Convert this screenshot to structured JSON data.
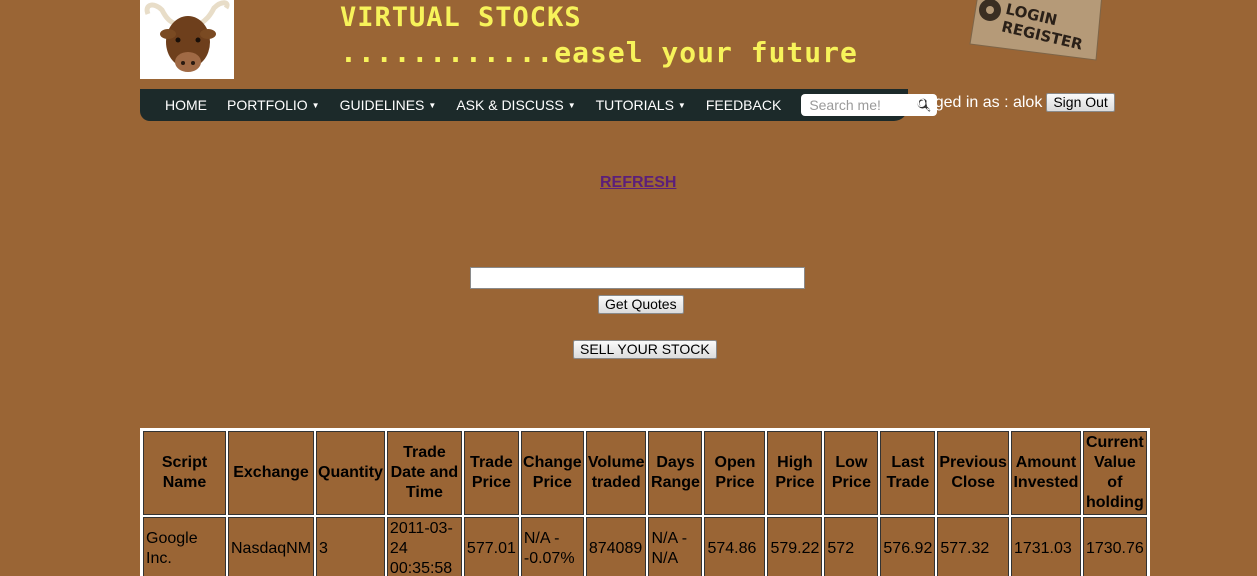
{
  "header": {
    "title": "VIRTUAL STOCKS",
    "tagline": "............easel your future",
    "login_tag": {
      "line1": "LOGIN",
      "line2": "REGISTER"
    }
  },
  "nav": {
    "items": [
      {
        "label": "HOME",
        "has_dropdown": false
      },
      {
        "label": "PORTFOLIO",
        "has_dropdown": true
      },
      {
        "label": "GUIDELINES",
        "has_dropdown": true
      },
      {
        "label": "ASK & DISCUSS",
        "has_dropdown": true
      },
      {
        "label": "TUTORIALS",
        "has_dropdown": true
      },
      {
        "label": "FEEDBACK",
        "has_dropdown": false
      }
    ],
    "search_placeholder": "Search me!"
  },
  "user": {
    "logged_in_text": "Logged in as : alok",
    "sign_out_label": "Sign Out"
  },
  "actions": {
    "refresh_label": "REFRESH",
    "quote_input_value": "",
    "get_quotes_label": "Get Quotes",
    "sell_stock_label": "SELL YOUR STOCK"
  },
  "holdings": {
    "columns": [
      "Script Name",
      "Exchange",
      "Quantity",
      "Trade Date and Time",
      "Trade Price",
      "Change Price",
      "Volume traded",
      "Days Range",
      "Open Price",
      "High Price",
      "Low Price",
      "Last Trade",
      "Previous Close",
      "Amount Invested",
      "Current Value of holding"
    ],
    "rows": [
      [
        "Google Inc.",
        "NasdaqNM",
        "3",
        "2011-03-24 00:35:58",
        "577.01",
        "N/A - -0.07%",
        "874089",
        "N/A - N/A",
        "574.86",
        "579.22",
        "572",
        "576.92",
        "577.32",
        "1731.03",
        "1730.76"
      ]
    ]
  },
  "colors": {
    "background": "#9a6535",
    "title": "#f7f35a",
    "nav_bg": "#1c2a2a",
    "link": "#5b1f7a"
  }
}
